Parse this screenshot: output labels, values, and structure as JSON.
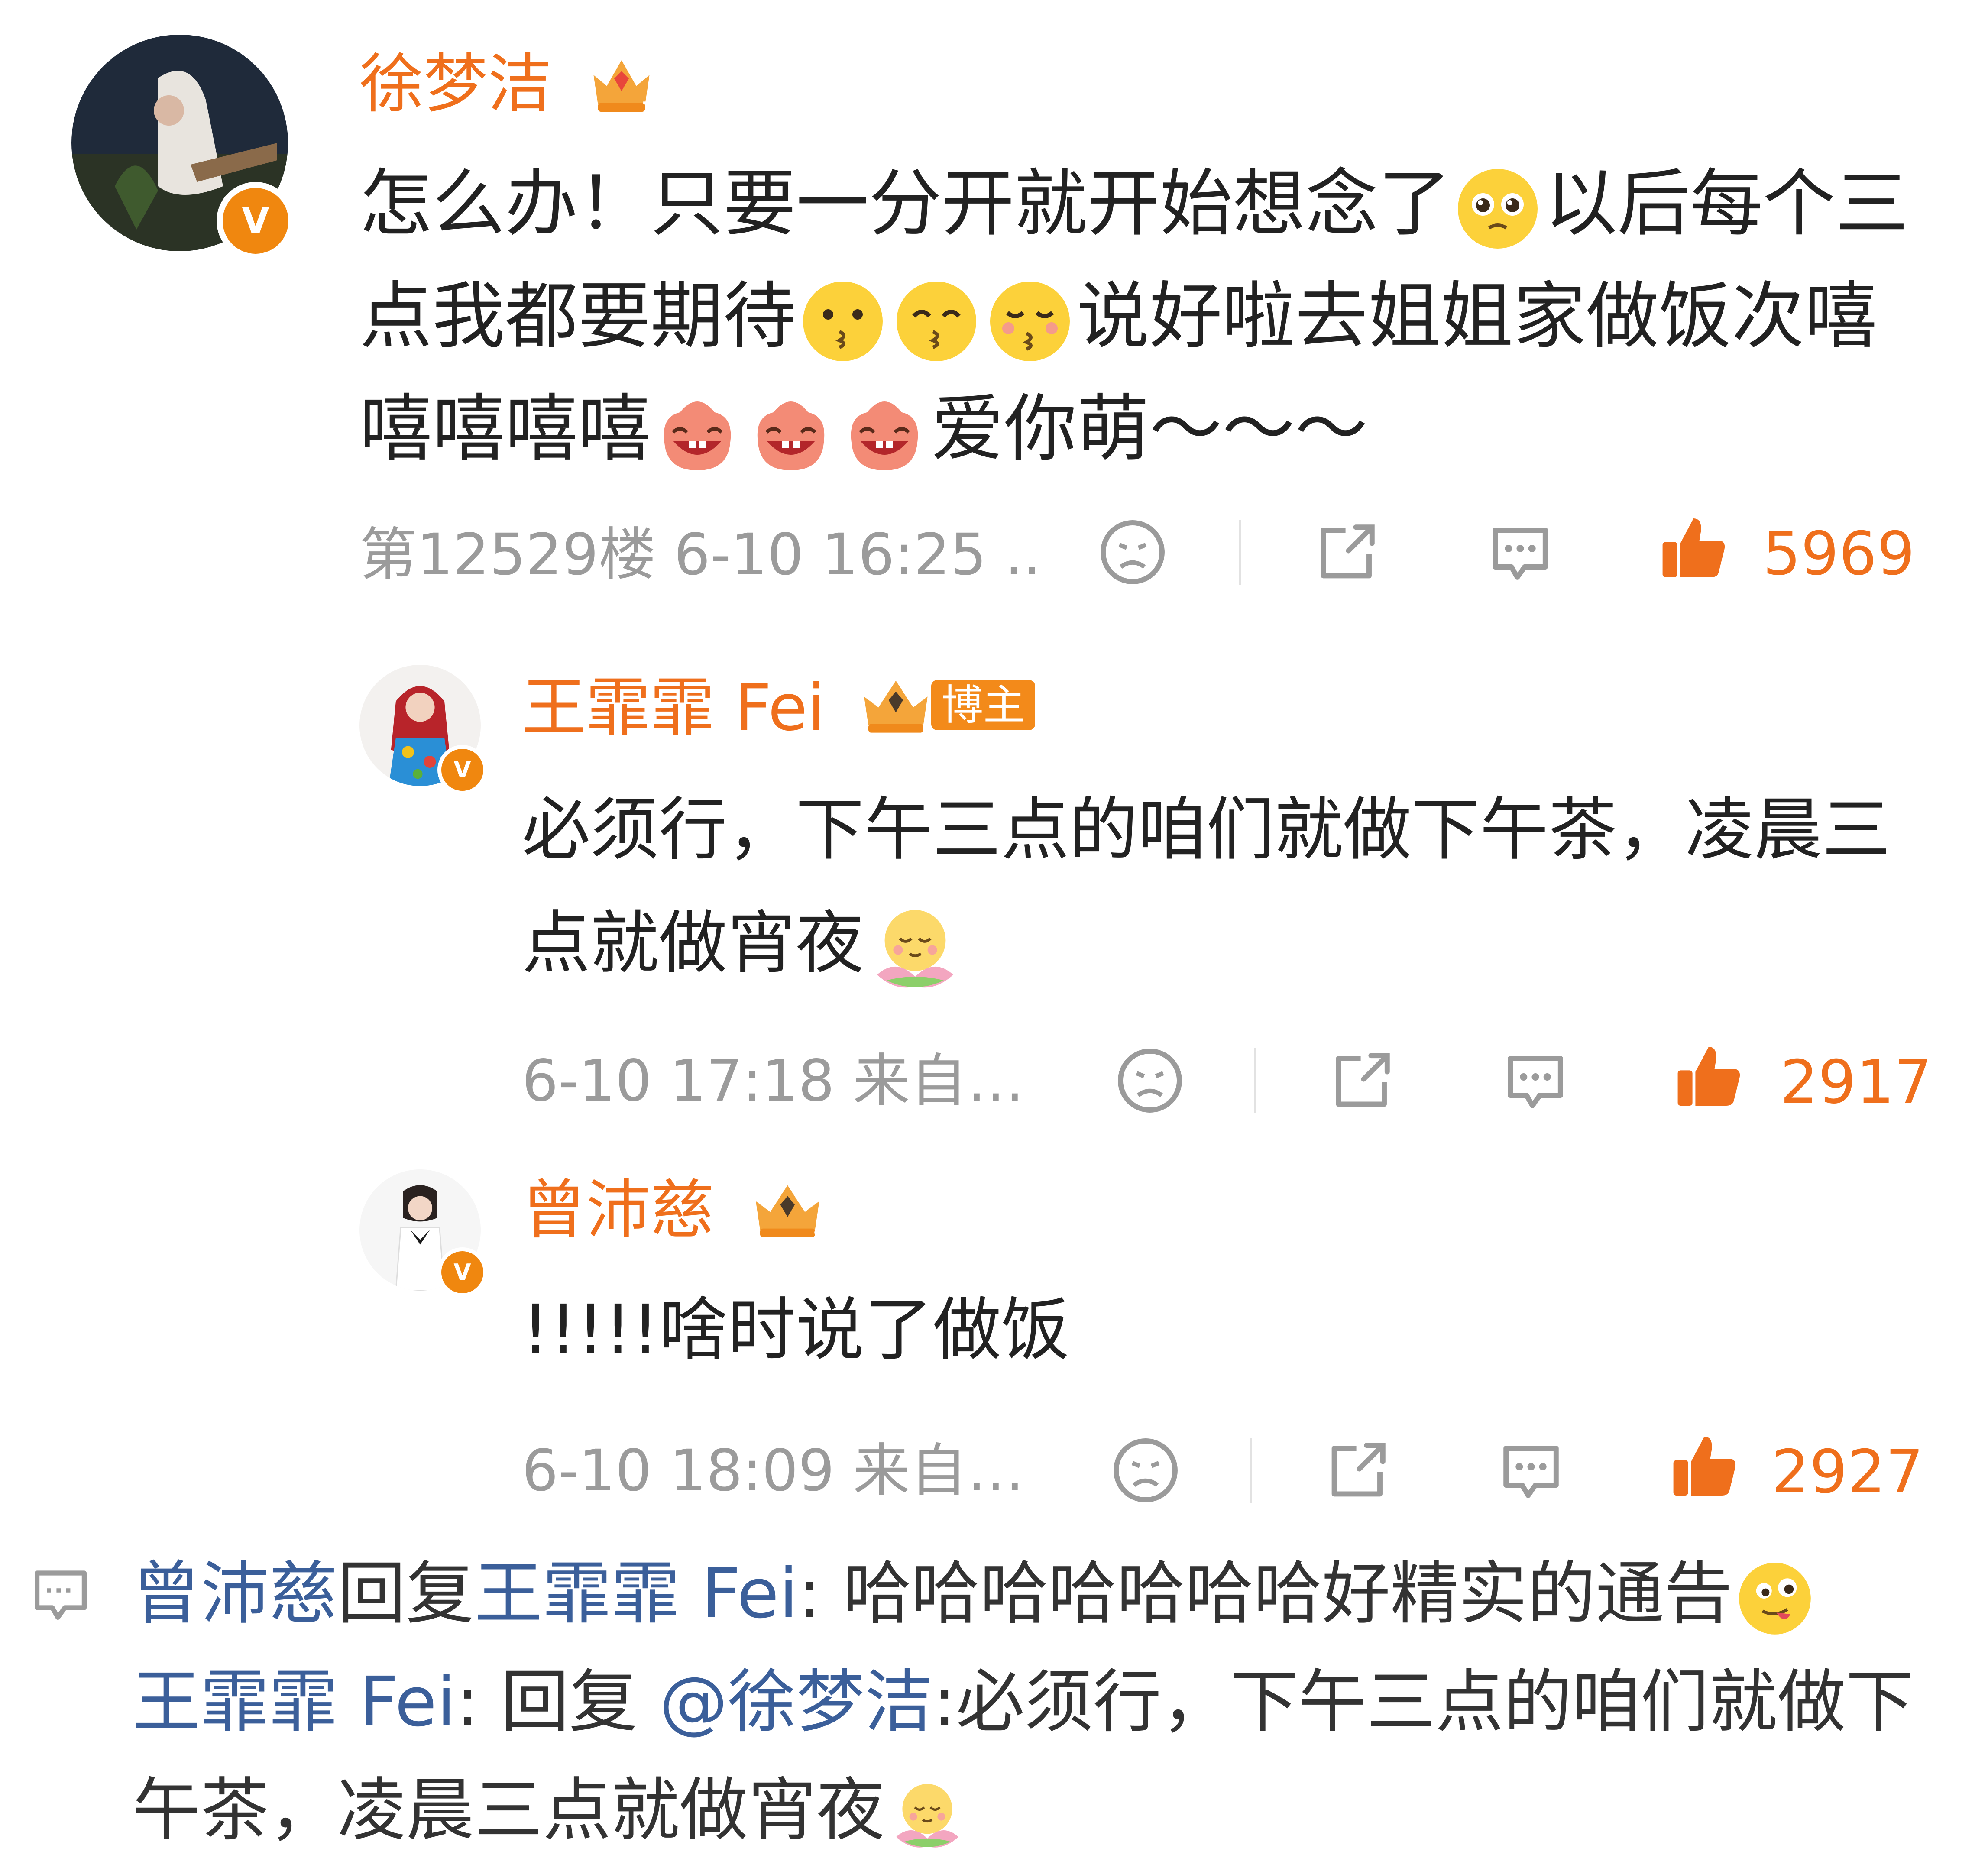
{
  "colors": {
    "username": "#ef6f1c",
    "meta": "#9b9b9b",
    "like": "#ef6f1c",
    "link": "#3b5f9a",
    "verified": "#f0870f"
  },
  "comment1": {
    "username": "徐梦洁",
    "text_a": "怎么办！只要一分开就开始想念了",
    "text_b": "以后每个三点我都要期待",
    "text_c": "说好啦去姐姐家做饭次嘻嘻嘻嘻嘻",
    "text_d": "爱你萌～～～",
    "floor": "第12529楼 6-10 16:25 ..",
    "likes": "5969",
    "verified_badge": "V"
  },
  "reply1": {
    "username": "王霏霏 Fei",
    "blogger_tag": "博主",
    "text": "必须行，下午三点的咱们就做下午茶，凌晨三点就做宵夜",
    "time": "6-10 17:18  来自…",
    "likes": "2917",
    "verified_badge": "V"
  },
  "reply2": {
    "username": "曾沛慈",
    "text": "!!!!!啥时说了做饭",
    "time": "6-10 18:09  来自…",
    "likes": "2927",
    "verified_badge": "V"
  },
  "thread": {
    "line1_user": "曾沛慈",
    "line1_mid": "回复",
    "line1_target": "王霏霏 Fei",
    "line1_text": ": 哈哈哈哈哈哈哈好精实的通告",
    "line2_user": "王霏霏 Fei",
    "line2_mid": ": 回复 ",
    "line2_mention": "@徐梦洁",
    "line2_text": ":必须行，下午三点的咱们就做下午茶，凌晨三点就做宵夜"
  }
}
